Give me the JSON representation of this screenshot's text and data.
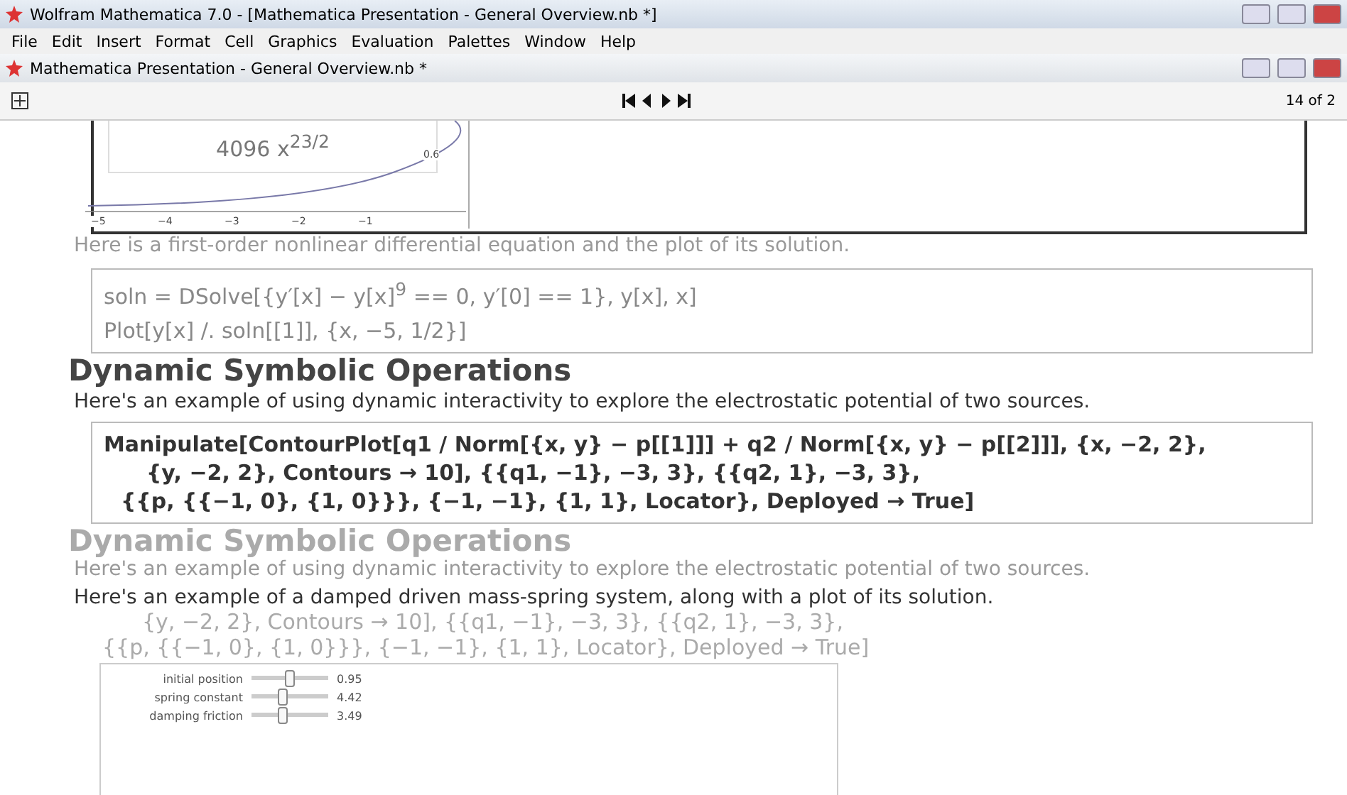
{
  "window": {
    "title": "Wolfram Mathematica 7.0 - [Mathematica Presentation - General Overview.nb *]"
  },
  "menu": [
    "File",
    "Edit",
    "Insert",
    "Format",
    "Cell",
    "Graphics",
    "Evaluation",
    "Palettes",
    "Window",
    "Help"
  ],
  "document": {
    "title": "Mathematica Presentation - General Overview.nb *",
    "page_counter": "14 of 2"
  },
  "plot": {
    "legend": "4096 x$^{23/2}$",
    "y_tick": "0.6",
    "x_ticks": [
      "−5",
      "−4",
      "−3",
      "−2",
      "−1"
    ]
  },
  "text_1": "Here is a first-order nonlinear differential equation and the plot of its solution.",
  "input_cell": [
    "soln = DSolve[{y′[x] − y[x]$^{9}$ == 0, y′[0] == 1}, y[x], x]",
    "Plot[y[x] /. soln[[1]], {x, −5, 1/2}]"
  ],
  "text_2": "Here's an example of using dynamic interactivity to explore the electrostatic potential of two sources.",
  "manipulate_cell": [
    "Manipulate[ContourPlot[q1 / Norm[{x, y} − p[[1]]] + q2 / Norm[{x, y} − p[[2]]], {x, −2, 2},",
    "{y, −2, 2}, Contours → 10], {{q1, −1}, −3, 3}, {{q2, 1}, −3, 3},",
    "{{p, {{−1, 0}, {1, 0}}}, {−1, −1}, {1, 1}, Locator}, Deployed → True]"
  ],
  "ghost_headings": [
    "Dynamic Symbolic Operations",
    "Dynamic Symbolic Operations"
  ],
  "ghost_text": "Here's an example of using dynamic interactivity to explore the electrostatic potential of two sources.",
  "text_3": "Here's an example of a damped driven mass-spring system, along with a plot of its solution.",
  "ghost_code": [
    "{y, −2, 2}, Contours → 10], {{q1, −1}, −3, 3}, {{q2, 1}, −3, 3},",
    "{{p, {{−1, 0}, {1, 0}}}, {−1, −1}, {1, 1}, Locator}, Deployed → True]"
  ],
  "controls": [
    {
      "label": "initial position",
      "level": 0.5,
      "reading": "0.95"
    },
    {
      "label": "spring constant",
      "level": 0.4,
      "reading": "4.42"
    },
    {
      "label": "damping friction",
      "level": 0.4,
      "reading": "3.49"
    }
  ]
}
